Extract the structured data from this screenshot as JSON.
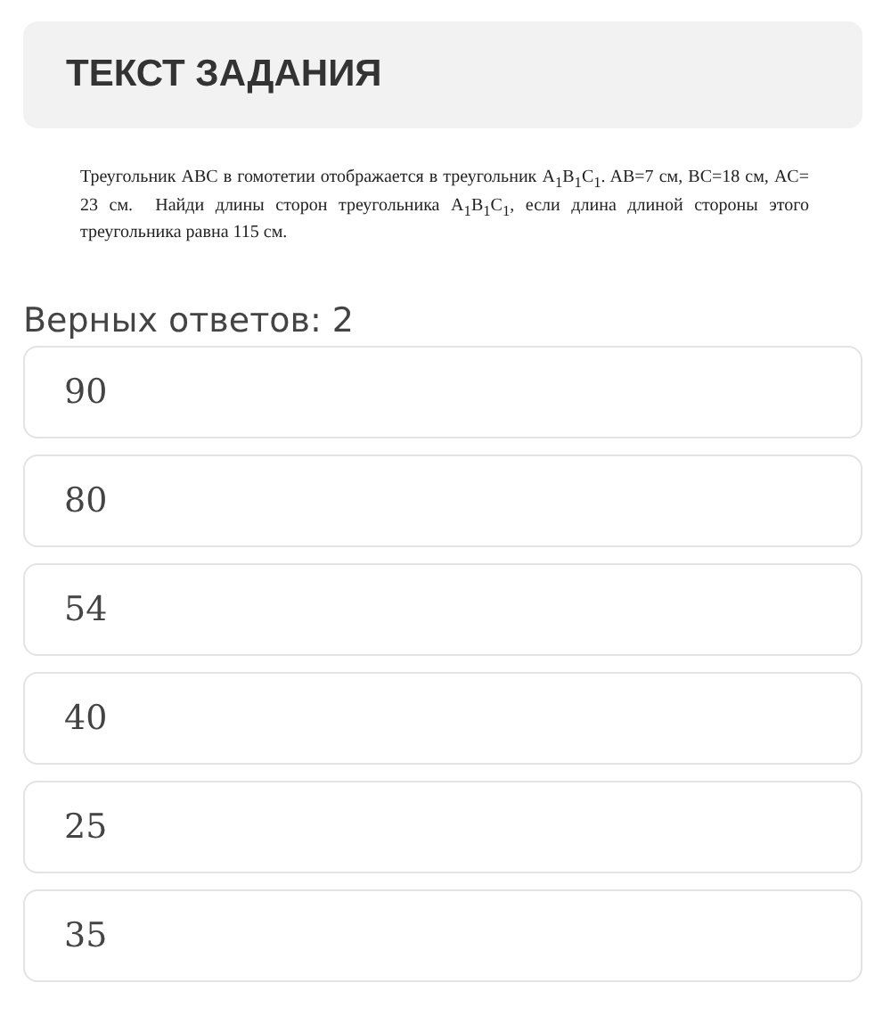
{
  "header": {
    "title": "ТЕКСТ ЗАДАНИЯ"
  },
  "task_text": "Треугольник ABC в гомотетии отображается в треугольник A$_{1}$B$_{1}$C$_{1}$. AB=7 см, BC=18 см, AC= 23 см.  Найди длины сторон треугольника A$_{1}$B$_{1}$C$_{1}$, если длина длиной стороны этого треугольника равна 115 см.",
  "answers_count_label": "Верных ответов: 2",
  "options": [
    {
      "label": "90",
      "selected": false
    },
    {
      "label": "80",
      "selected": false
    },
    {
      "label": "54",
      "selected": false
    },
    {
      "label": "40",
      "selected": false
    },
    {
      "label": "25",
      "selected": false
    },
    {
      "label": "35",
      "selected": false
    }
  ]
}
